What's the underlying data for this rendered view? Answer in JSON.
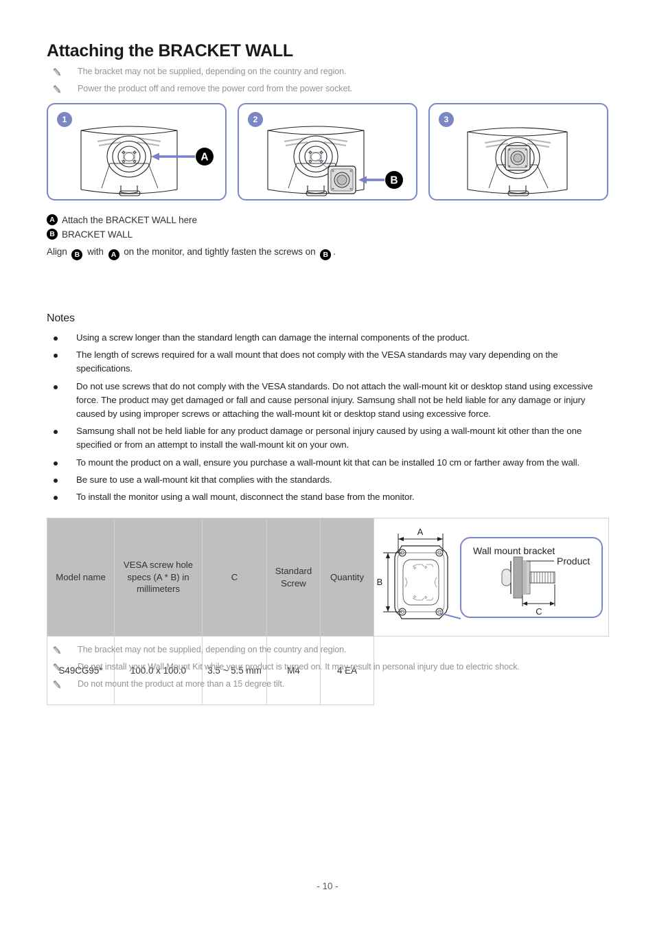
{
  "document": {
    "title": "Attaching the BRACKET WALL",
    "page_number": "- 10 -"
  },
  "colors": {
    "step_border": "#7b86c4",
    "step_badge": "#7b86c4",
    "arrow": "#7a7fc8",
    "marker": "#000000",
    "table_header": "#bfbfbf",
    "note_text": "#949494"
  },
  "top_notes": [
    {
      "icon": "pencil-icon",
      "text": "The bracket may not be supplied, depending on the country and region."
    },
    {
      "icon": "pencil-icon",
      "text": "Power the product off and remove the power cord from the power socket."
    }
  ],
  "steps": [
    {
      "badge": "1",
      "callout": "A",
      "art": "monitor-back-vesa-circle"
    },
    {
      "badge": "2",
      "callout": "B",
      "art": "monitor-back-with-bracket"
    },
    {
      "badge": "3",
      "callout": "",
      "art": "monitor-back-bracket-attached"
    }
  ],
  "legend": {
    "items": [
      {
        "marker": "A",
        "label": "Attach the BRACKET WALL here"
      },
      {
        "marker": "B",
        "label": "BRACKET WALL"
      }
    ],
    "sentence": {
      "part1": "Align ",
      "marker1": "B",
      "part2": " with ",
      "marker2": "A",
      "part3": " on the monitor, and tightly fasten the screws on ",
      "marker3": "B",
      "part4": "."
    }
  },
  "notes": {
    "heading": "Notes",
    "items": [
      "Using a screw longer than the standard length can damage the internal components of the product.",
      "The length of screws required for a wall mount that does not comply with the VESA standards may vary depending on the specifications.",
      "Do not use screws that do not comply with the VESA standards. Do not attach the wall-mount kit or desktop stand using excessive force. The product may get damaged or fall and cause personal injury. Samsung shall not be held liable for any damage or injury caused by using improper screws or attaching the wall-mount kit or desktop stand using excessive force.",
      "Samsung shall not be held liable for any product damage or personal injury caused by using a wall-mount kit other than the one specified or from an attempt to install the wall-mount kit on your own.",
      "To mount the product on a wall, ensure you purchase a wall-mount kit that can be installed 10 cm or farther away from the wall.",
      "Be sure to use a wall-mount kit that complies with the standards.",
      "To install the monitor using a wall mount, disconnect the stand base from the monitor."
    ]
  },
  "spec_table": {
    "headers": [
      "Model name",
      "VESA screw hole specs (A * B) in millimeters",
      "C",
      "Standard Screw",
      "Quantity"
    ],
    "rows": [
      [
        "S49CG95*",
        "100.0 x 100.0",
        "3.5 ~ 5.5 mm",
        "M4",
        "4 EA"
      ]
    ],
    "diagram": {
      "dim_a": "A",
      "dim_b": "B",
      "dim_c": "C",
      "callout_bracket": "Wall mount bracket",
      "callout_product": "Product"
    }
  },
  "bottom_notes": [
    {
      "icon": "pencil-icon",
      "text": "The bracket may not be supplied, depending on the country and region."
    },
    {
      "icon": "pencil-icon",
      "text": "Do not install your Wall Mount Kit while your product is turned on. It may result in personal injury due to electric shock."
    },
    {
      "icon": "pencil-icon",
      "text": "Do not mount the product at more than a 15 degree tilt."
    }
  ]
}
